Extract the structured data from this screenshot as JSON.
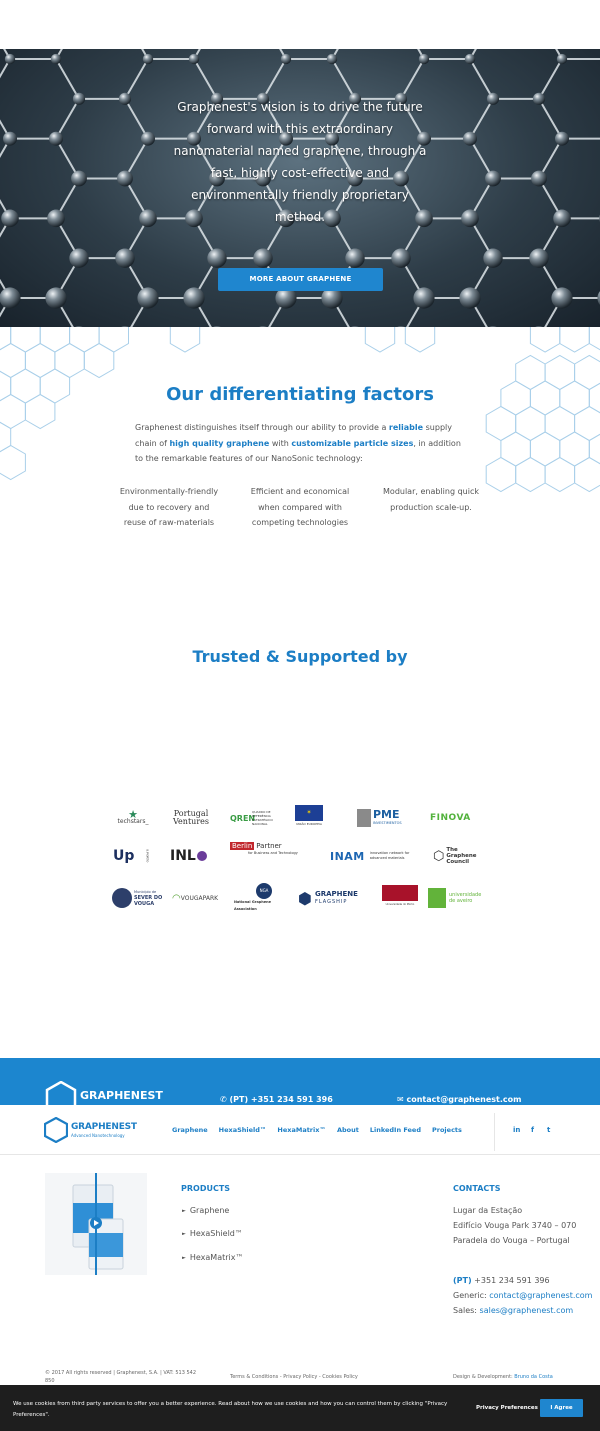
{
  "hero": {
    "text": "Graphenest's vision is to drive the future forward with this extraordinary nanomaterial named graphene, through a fast, highly cost-effective and environmentally friendly proprietary method.",
    "button_label": "MORE ABOUT GRAPHENE"
  },
  "differentiating": {
    "title": "Our differentiating factors",
    "para_1": "Graphenest distinguishes itself through our ability to provide a ",
    "hl_1": "reliable",
    "para_2": " supply chain of ",
    "hl_2": "high quality graphene",
    "para_3": " with ",
    "hl_3": "customizable particle sizes",
    "para_4": ", in addition to the remarkable features of our NanoSonic technology:",
    "factors": [
      "Environmentally-friendly due to recovery and reuse of raw-materials",
      "Efficient and economical when compared with competing technologies",
      "Modular, enabling quick production scale-up."
    ]
  },
  "trusted": {
    "title": "Trusted & Supported by",
    "logos": {
      "techstars": "techstars_",
      "portugal_ventures_1": "Portugal",
      "portugal_ventures_2": "Ventures",
      "qren_1": "QREN",
      "qren_2": "QUADRO DE REFERÊNCIA ESTRATÉGICO NACIONAL",
      "eu": "UNIÃO EUROPEIA",
      "pme_1": "PME",
      "pme_2": "INVESTIMENTOS",
      "finova": "FINOVA",
      "up": "U.PORTO",
      "inl": "INL",
      "berlin_1": "Berlin",
      "berlin_2": "Partner",
      "berlin_3": "for Business and Technology",
      "inam_1": "INAM",
      "inam_2": "innovation network for advanced materials",
      "graphene_council_1": "The",
      "graphene_council_2": "Graphene",
      "graphene_council_3": "Council",
      "sever_1": "Município de",
      "sever_2": "SEVER DO",
      "sever_3": "VOUGA",
      "vougapark": "VOUGAPARK",
      "nga_1": "NGA",
      "nga_2": "National Graphene Association",
      "flagship_1": "GRAPHENE",
      "flagship_2": "FLAGSHIP",
      "minho": "Universidade do Minho",
      "aveiro_1": "universidade",
      "aveiro_2": "de aveiro"
    }
  },
  "bluebar": {
    "brand": "GRAPHENEST",
    "phone": "(PT) +351 234 591 396",
    "email": "contact@graphenest.com"
  },
  "nav": {
    "brand": "GRAPHENEST",
    "subtitle": "Advanced Nanotechnology",
    "items": [
      "Graphene",
      "HexaShield™",
      "HexaMatrix™",
      "About",
      "LinkedIn Feed",
      "Projects"
    ],
    "social": [
      "in",
      "f",
      "t"
    ]
  },
  "footer": {
    "products_title": "PRODUCTS",
    "products": [
      "Graphene",
      "HexaShield™",
      "HexaMatrix™"
    ],
    "contacts_title": "CONTACTS",
    "address": [
      "Lugar da Estação",
      "Edifício Vouga Park 3740 – 070",
      "Paradela do Vouga – Portugal"
    ],
    "phone_label": "(PT)",
    "phone": " +351 234 591 396",
    "generic_label": "Generic: ",
    "generic_email": "contact@graphenest.com",
    "sales_label": "Sales: ",
    "sales_email": "sales@graphenest.com",
    "copyright_1": "© 2017 All rights reserved | Graphenest, S.A. | VAT: 513 542",
    "copyright_2": "850",
    "legal": "Terms & Conditions  -  Privacy Policy  -  Cookies Policy",
    "design_label": "Design & Development: ",
    "design_name": "Bruno da Costa"
  },
  "cookie": {
    "text": "We use cookies from third party services to offer you a better experience. Read about how we use cookies and how you can control them by clicking \"Privacy Preferences\".",
    "prefs_label": "Privacy Preferences",
    "agree_label": "I Agree"
  },
  "colors": {
    "brand_blue": "#1c7ec5",
    "button_blue": "#1f86cf",
    "cookie_bg": "#1e1e1e"
  }
}
